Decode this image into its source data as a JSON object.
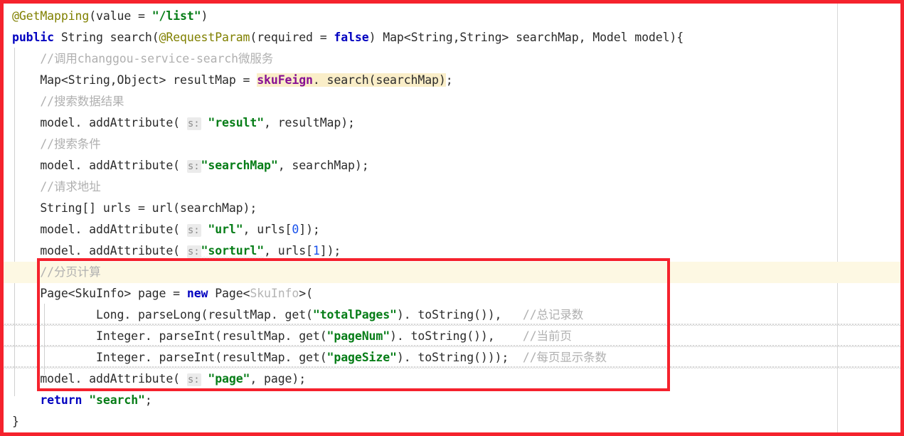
{
  "editor": {
    "language": "java",
    "theme": "light",
    "annotation_color": "#f5222d",
    "current_line_highlight_color": "#fdf8e3",
    "search_highlight_color": "#faeec8",
    "lines": [
      {
        "n": 1,
        "parts": [
          {
            "t": "@GetMapping",
            "c": "anno"
          },
          {
            "t": "(value = ",
            "c": "plain"
          },
          {
            "t": "\"/list\"",
            "c": "str"
          },
          {
            "t": ")",
            "c": "plain"
          }
        ]
      },
      {
        "n": 2,
        "parts": [
          {
            "t": "public",
            "c": "kw"
          },
          {
            "t": " String search(",
            "c": "plain"
          },
          {
            "t": "@RequestParam",
            "c": "anno"
          },
          {
            "t": "(required = ",
            "c": "plain"
          },
          {
            "t": "false",
            "c": "kw"
          },
          {
            "t": ") Map<String,String> searchMap, Model model){",
            "c": "plain"
          }
        ]
      },
      {
        "n": 3,
        "parts": [
          {
            "t": "    //调用changgou-service-search微服务",
            "c": "cmt"
          }
        ]
      },
      {
        "n": 4,
        "parts": [
          {
            "t": "    Map<String,Object> resultMap = ",
            "c": "plain"
          },
          {
            "t": "skuFeign",
            "c": "field",
            "hl": "search"
          },
          {
            "t": ". search(searchMap)",
            "c": "plain",
            "hl": "search"
          },
          {
            "t": ";",
            "c": "plain"
          }
        ]
      },
      {
        "n": 5,
        "parts": [
          {
            "t": "    //搜索数据结果",
            "c": "cmt"
          }
        ]
      },
      {
        "n": 6,
        "parts": [
          {
            "t": "    model. addAttribute( ",
            "c": "plain"
          },
          {
            "t": "s:",
            "c": "hint"
          },
          {
            "t": " ",
            "c": "plain"
          },
          {
            "t": "\"result\"",
            "c": "str"
          },
          {
            "t": ", resultMap);",
            "c": "plain"
          }
        ]
      },
      {
        "n": 7,
        "parts": [
          {
            "t": "    //搜索条件",
            "c": "cmt"
          }
        ]
      },
      {
        "n": 8,
        "parts": [
          {
            "t": "    model. addAttribute( ",
            "c": "plain"
          },
          {
            "t": "s:",
            "c": "hint"
          },
          {
            "t": "",
            "c": "plain"
          },
          {
            "t": "\"searchMap\"",
            "c": "str"
          },
          {
            "t": ", searchMap);",
            "c": "plain"
          }
        ]
      },
      {
        "n": 9,
        "parts": [
          {
            "t": "    //请求地址",
            "c": "cmt"
          }
        ]
      },
      {
        "n": 10,
        "parts": [
          {
            "t": "    String[] urls = url(searchMap);",
            "c": "plain"
          }
        ]
      },
      {
        "n": 11,
        "parts": [
          {
            "t": "    model. addAttribute( ",
            "c": "plain"
          },
          {
            "t": "s:",
            "c": "hint"
          },
          {
            "t": " ",
            "c": "plain"
          },
          {
            "t": "\"url\"",
            "c": "str"
          },
          {
            "t": ", urls[",
            "c": "plain"
          },
          {
            "t": "0",
            "c": "num"
          },
          {
            "t": "]);",
            "c": "plain"
          }
        ]
      },
      {
        "n": 12,
        "parts": [
          {
            "t": "    model. addAttribute( ",
            "c": "plain"
          },
          {
            "t": "s:",
            "c": "hint"
          },
          {
            "t": "",
            "c": "plain"
          },
          {
            "t": "\"sorturl\"",
            "c": "str",
            "squig": true
          },
          {
            "t": ", urls[",
            "c": "plain"
          },
          {
            "t": "1",
            "c": "num"
          },
          {
            "t": "]);",
            "c": "plain"
          }
        ]
      },
      {
        "n": 13,
        "highlight": true,
        "parts": [
          {
            "t": "    //分页计算",
            "c": "cmt"
          }
        ]
      },
      {
        "n": 14,
        "parts": [
          {
            "t": "    Page<SkuInfo> page = ",
            "c": "plain"
          },
          {
            "t": "new",
            "c": "kw"
          },
          {
            "t": " Page<",
            "c": "plain"
          },
          {
            "t": "SkuInfo",
            "c": "dim"
          },
          {
            "t": ">(",
            "c": "plain"
          }
        ]
      },
      {
        "n": 15,
        "squiggly": true,
        "parts": [
          {
            "t": "            Long. parseLong(resultMap. get(",
            "c": "plain"
          },
          {
            "t": "\"totalPages\"",
            "c": "str"
          },
          {
            "t": "). toString()),   ",
            "c": "plain"
          },
          {
            "t": "//总记录数",
            "c": "cmt"
          }
        ]
      },
      {
        "n": 16,
        "squiggly": true,
        "parts": [
          {
            "t": "            Integer. parseInt(resultMap. get(",
            "c": "plain"
          },
          {
            "t": "\"pageNum\"",
            "c": "str"
          },
          {
            "t": "). toString()),    ",
            "c": "plain"
          },
          {
            "t": "//当前页",
            "c": "cmt"
          }
        ]
      },
      {
        "n": 17,
        "squiggly": true,
        "parts": [
          {
            "t": "            Integer. parseInt(resultMap. get(",
            "c": "plain"
          },
          {
            "t": "\"pageSize\"",
            "c": "str"
          },
          {
            "t": "). toString()));  ",
            "c": "plain"
          },
          {
            "t": "//每页显示条数",
            "c": "cmt"
          }
        ]
      },
      {
        "n": 18,
        "parts": [
          {
            "t": "    model. addAttribute( ",
            "c": "plain"
          },
          {
            "t": "s:",
            "c": "hint"
          },
          {
            "t": " ",
            "c": "plain"
          },
          {
            "t": "\"page\"",
            "c": "str"
          },
          {
            "t": ", page);",
            "c": "plain"
          }
        ]
      },
      {
        "n": 19,
        "parts": [
          {
            "t": "    ",
            "c": "plain"
          },
          {
            "t": "return",
            "c": "kw"
          },
          {
            "t": " ",
            "c": "plain"
          },
          {
            "t": "\"search\"",
            "c": "str"
          },
          {
            "t": ";",
            "c": "plain"
          }
        ]
      },
      {
        "n": 20,
        "parts": [
          {
            "t": "}",
            "c": "plain"
          }
        ]
      }
    ],
    "annotations": {
      "outer_box_label": "outer-red-highlight-box",
      "inner_box_label": "pagination-code-highlight-box"
    }
  }
}
